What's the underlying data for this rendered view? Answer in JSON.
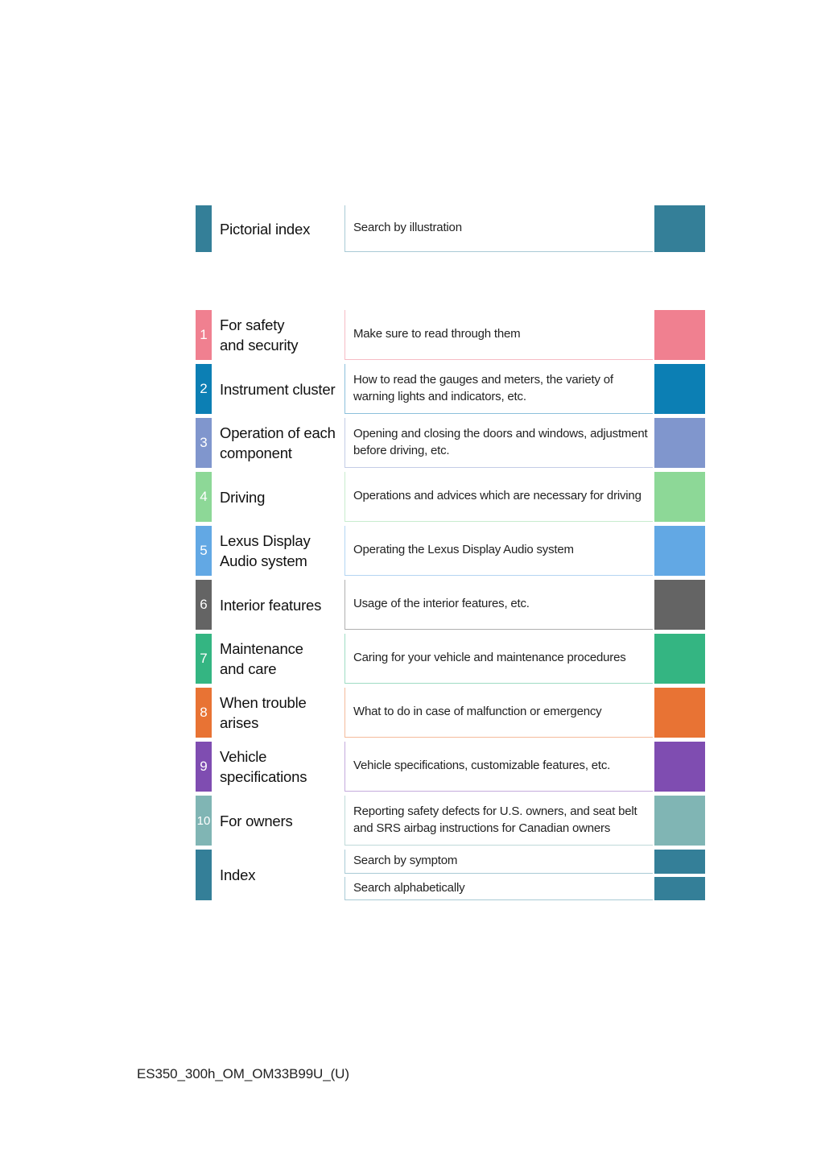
{
  "pictorial": {
    "title": "Pictorial index",
    "description": "Search by illustration",
    "color": "#347f98",
    "line_color": "#a9cad5"
  },
  "chapters": [
    {
      "number": "1",
      "title": "For safety and security",
      "title_lines": [
        "For safety",
        "and security"
      ],
      "description": "Make sure to read through them",
      "color": "#f08090",
      "line_color": "#f6bcc5"
    },
    {
      "number": "2",
      "title": "Instrument cluster",
      "title_lines": [
        "Instrument cluster"
      ],
      "description": "How to read the gauges and meters, the variety of warning lights and indicators, etc.",
      "color": "#0c7fb4",
      "line_color": "#8cc0db"
    },
    {
      "number": "3",
      "title": "Operation of each component",
      "title_lines": [
        "Operation of each",
        "component"
      ],
      "description": "Opening and closing the doors and windows, adjustment before driving, etc.",
      "color": "#8096cd",
      "line_color": "#c3cce6"
    },
    {
      "number": "4",
      "title": "Driving",
      "title_lines": [
        "Driving"
      ],
      "description": "Operations and advices which are necessary for driving",
      "color": "#8dd897",
      "line_color": "#c8ecce"
    },
    {
      "number": "5",
      "title": "Lexus Display Audio system",
      "title_lines": [
        "Lexus Display",
        "Audio system"
      ],
      "description": "Operating the Lexus Display Audio system",
      "color": "#62a8e4",
      "line_color": "#b4d5f2"
    },
    {
      "number": "6",
      "title": "Interior features",
      "title_lines": [
        "Interior features"
      ],
      "description": "Usage of the interior features, etc.",
      "color": "#646464",
      "line_color": "#b0b0b0"
    },
    {
      "number": "7",
      "title": "Maintenance and care",
      "title_lines": [
        "Maintenance",
        "and care"
      ],
      "description": "Caring for your vehicle and maintenance procedures",
      "color": "#34b582",
      "line_color": "#9fdcc4"
    },
    {
      "number": "8",
      "title": "When trouble arises",
      "title_lines": [
        "When trouble",
        "arises"
      ],
      "description": "What to do in case of malfunction or emergency",
      "color": "#e87334",
      "line_color": "#f4bb9b"
    },
    {
      "number": "9",
      "title": "Vehicle specifications",
      "title_lines": [
        "Vehicle",
        "specifications"
      ],
      "description": "Vehicle specifications, customizable features, etc.",
      "color": "#7f4db1",
      "line_color": "#c4aadc"
    },
    {
      "number": "10",
      "title": "For owners",
      "title_lines": [
        "For owners"
      ],
      "description": "Reporting safety defects for U.S. owners, and seat belt and SRS airbag instructions for Canadian owners",
      "color": "#80b5b4",
      "line_color": "#c0dad9"
    }
  ],
  "index": {
    "title": "Index",
    "color": "#347f98",
    "line_color": "#a9cad5",
    "items": [
      {
        "description": "Search by symptom"
      },
      {
        "description": "Search alphabetically"
      }
    ]
  },
  "footer": {
    "code": "ES350_300h_OM_OM33B99U_(U)"
  }
}
